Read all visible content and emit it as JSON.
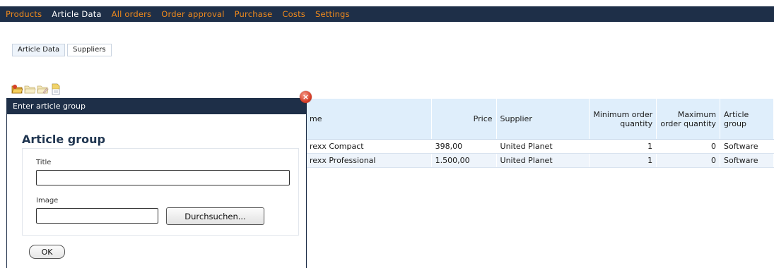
{
  "nav": {
    "items": [
      {
        "label": "Products",
        "active": false
      },
      {
        "label": "Article Data",
        "active": true
      },
      {
        "label": "All orders",
        "active": false
      },
      {
        "label": "Order approval",
        "active": false
      },
      {
        "label": "Purchase",
        "active": false
      },
      {
        "label": "Costs",
        "active": false
      },
      {
        "label": "Settings",
        "active": false
      }
    ]
  },
  "subtabs": [
    {
      "label": "Article Data",
      "active": true
    },
    {
      "label": "Suppliers",
      "active": false
    }
  ],
  "toolbar": {
    "icons": [
      "open-folder-icon",
      "folder-icon",
      "folder-edit-icon",
      "document-icon"
    ]
  },
  "table": {
    "columns": [
      "me",
      "Price",
      "Supplier",
      "Minimum order quantity",
      "Maximum order quantity",
      "Article group"
    ],
    "rows": [
      [
        "rexx Compact",
        "398,00",
        "United Planet",
        "1",
        "0",
        "Software"
      ],
      [
        "rexx Professional",
        "1.500,00",
        "United Planet",
        "1",
        "0",
        "Software"
      ]
    ]
  },
  "dialog": {
    "title": "Enter article group",
    "heading": "Article group",
    "title_label": "Title",
    "title_value": "",
    "image_label": "Image",
    "image_value": "",
    "browse_label": "Durchsuchen...",
    "ok_label": "OK"
  },
  "colors": {
    "nav_bg": "#1e2f48",
    "nav_text": "#f08a1c",
    "nav_active": "#ffffff",
    "header_bg": "#dfeefb",
    "row_alt": "#eef4fb",
    "close_red": "#d6402a"
  }
}
